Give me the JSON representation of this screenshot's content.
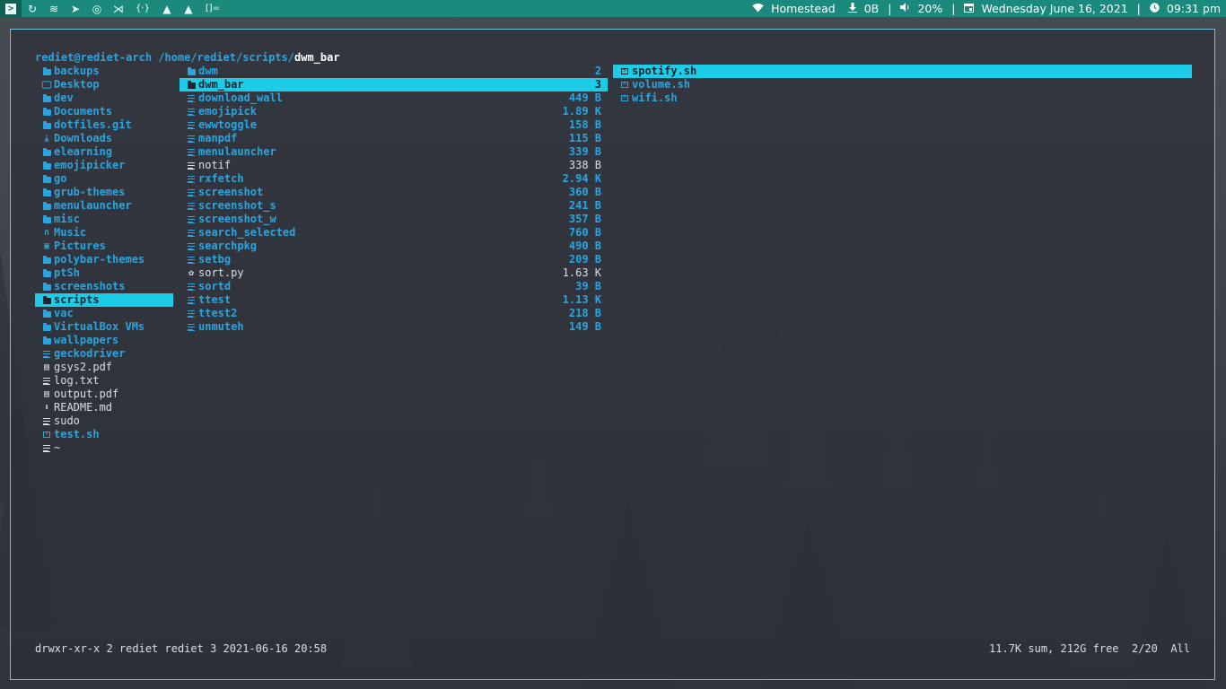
{
  "topbar": {
    "tags": [
      {
        "icon": "terminal-icon",
        "glyph": ">"
      },
      {
        "icon": "refresh-icon",
        "glyph": "↻"
      },
      {
        "icon": "spotify-icon",
        "glyph": "≋"
      },
      {
        "icon": "telegram-icon",
        "glyph": "➤"
      },
      {
        "icon": "compass-icon",
        "glyph": "◎"
      },
      {
        "icon": "vscode-icon",
        "glyph": "⋊"
      },
      {
        "icon": "braces-icon",
        "glyph": "{·}"
      },
      {
        "icon": "arch-icon",
        "glyph": "▲"
      },
      {
        "icon": "arch-alt-icon",
        "glyph": "▲"
      },
      {
        "icon": "layout-icon",
        "glyph": "[]="
      }
    ],
    "wifi_label": "Homestead",
    "download_label": "0B",
    "volume_label": "20%",
    "date_label": "Wednesday June 16, 2021",
    "time_label": "09:31 pm",
    "separator": "|"
  },
  "ranger": {
    "user_host": "rediet@rediet-arch",
    "path_dir": "/home/rediet/scripts/",
    "path_current": "dwm_bar",
    "parent_column": [
      {
        "name": "backups",
        "type": "dir",
        "icon": "folder-icon"
      },
      {
        "name": "Desktop",
        "type": "dir",
        "icon": "desktop-icon"
      },
      {
        "name": "dev",
        "type": "dir",
        "icon": "folder-icon"
      },
      {
        "name": "Documents",
        "type": "dir",
        "icon": "document-icon"
      },
      {
        "name": "dotfiles.git",
        "type": "dir",
        "icon": "folder-icon"
      },
      {
        "name": "Downloads",
        "type": "dir",
        "icon": "download-folder-icon"
      },
      {
        "name": "elearning",
        "type": "dir",
        "icon": "folder-icon"
      },
      {
        "name": "emojipicker",
        "type": "dir",
        "icon": "folder-icon"
      },
      {
        "name": "go",
        "type": "dir",
        "icon": "folder-icon"
      },
      {
        "name": "grub-themes",
        "type": "dir",
        "icon": "folder-icon"
      },
      {
        "name": "menulauncher",
        "type": "dir",
        "icon": "folder-icon"
      },
      {
        "name": "misc",
        "type": "dir",
        "icon": "folder-icon"
      },
      {
        "name": "Music",
        "type": "dir",
        "icon": "headphones-icon"
      },
      {
        "name": "Pictures",
        "type": "dir",
        "icon": "image-icon"
      },
      {
        "name": "polybar-themes",
        "type": "dir",
        "icon": "folder-icon"
      },
      {
        "name": "ptSh",
        "type": "dir",
        "icon": "folder-icon"
      },
      {
        "name": "screenshots",
        "type": "dir",
        "icon": "folder-icon"
      },
      {
        "name": "scripts",
        "type": "dir",
        "icon": "folder-icon",
        "selected": true
      },
      {
        "name": "vac",
        "type": "dir",
        "icon": "folder-icon"
      },
      {
        "name": "VirtualBox VMs",
        "type": "dir",
        "icon": "folder-icon"
      },
      {
        "name": "wallpapers",
        "type": "dir",
        "icon": "folder-icon"
      },
      {
        "name": "geckodriver",
        "type": "exe",
        "icon": "file-lines-icon"
      },
      {
        "name": "gsys2.pdf",
        "type": "reg",
        "icon": "pdf-icon"
      },
      {
        "name": "log.txt",
        "type": "reg",
        "icon": "file-lines-icon"
      },
      {
        "name": "output.pdf",
        "type": "reg",
        "icon": "pdf-icon"
      },
      {
        "name": "README.md",
        "type": "reg",
        "icon": "markdown-icon"
      },
      {
        "name": "sudo",
        "type": "reg",
        "icon": "file-lines-icon"
      },
      {
        "name": "test.sh",
        "type": "exe",
        "icon": "shell-script-icon"
      },
      {
        "name": "~",
        "type": "reg",
        "icon": "file-lines-icon"
      }
    ],
    "current_column": [
      {
        "name": "dwm",
        "type": "dir",
        "icon": "folder-icon",
        "size": "2"
      },
      {
        "name": "dwm_bar",
        "type": "dir",
        "icon": "folder-icon",
        "size": "3",
        "selected": true
      },
      {
        "name": "download_wall",
        "type": "exe",
        "icon": "file-lines-icon",
        "size": "449 B"
      },
      {
        "name": "emojipick",
        "type": "exe",
        "icon": "file-lines-icon",
        "size": "1.89 K"
      },
      {
        "name": "ewwtoggle",
        "type": "exe",
        "icon": "file-lines-icon",
        "size": "158 B"
      },
      {
        "name": "manpdf",
        "type": "exe",
        "icon": "file-lines-icon",
        "size": "115 B"
      },
      {
        "name": "menulauncher",
        "type": "exe",
        "icon": "file-lines-icon",
        "size": "339 B"
      },
      {
        "name": "notif",
        "type": "reg",
        "icon": "file-lines-icon",
        "size": "338 B"
      },
      {
        "name": "rxfetch",
        "type": "exe",
        "icon": "file-lines-icon",
        "size": "2.94 K"
      },
      {
        "name": "screenshot",
        "type": "exe",
        "icon": "file-lines-icon",
        "size": "360 B"
      },
      {
        "name": "screenshot_s",
        "type": "exe",
        "icon": "file-lines-icon",
        "size": "241 B"
      },
      {
        "name": "screenshot_w",
        "type": "exe",
        "icon": "file-lines-icon",
        "size": "357 B"
      },
      {
        "name": "search_selected",
        "type": "exe",
        "icon": "file-lines-icon",
        "size": "760 B"
      },
      {
        "name": "searchpkg",
        "type": "exe",
        "icon": "file-lines-icon",
        "size": "490 B"
      },
      {
        "name": "setbg",
        "type": "exe",
        "icon": "file-lines-icon",
        "size": "209 B"
      },
      {
        "name": "sort.py",
        "type": "reg",
        "icon": "python-icon",
        "size": "1.63 K"
      },
      {
        "name": "sortd",
        "type": "exe",
        "icon": "file-lines-icon",
        "size": "39 B"
      },
      {
        "name": "ttest",
        "type": "exe",
        "icon": "file-lines-icon",
        "size": "1.13 K"
      },
      {
        "name": "ttest2",
        "type": "exe",
        "icon": "file-lines-icon",
        "size": "218 B"
      },
      {
        "name": "unmuteh",
        "type": "exe",
        "icon": "file-lines-icon",
        "size": "149 B"
      }
    ],
    "preview_column": [
      {
        "name": "spotify.sh",
        "type": "exe",
        "icon": "shell-script-icon",
        "selected": true
      },
      {
        "name": "volume.sh",
        "type": "exe",
        "icon": "shell-script-icon"
      },
      {
        "name": "wifi.sh",
        "type": "exe",
        "icon": "shell-script-icon"
      }
    ],
    "status_left": "drwxr-xr-x 2 rediet rediet 3 2021-06-16 20:58",
    "status_right": "11.7K sum, 212G free  2/20  All"
  },
  "colors": {
    "accent": "#1ccde8",
    "dir_blue": "#2aa5e0",
    "bar_teal": "#1b8a7c",
    "border": "#6fc4d8"
  }
}
